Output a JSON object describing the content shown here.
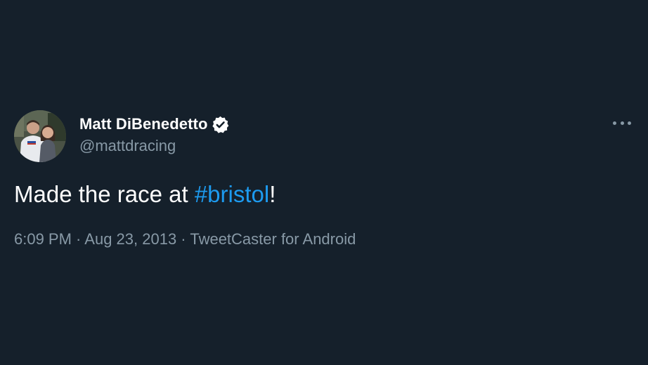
{
  "author": {
    "display_name": "Matt DiBenedetto",
    "handle": "@mattdracing",
    "verified_icon": "verified-badge-icon",
    "avatar_icon": "avatar-photo"
  },
  "tweet": {
    "text_before": "Made the race at ",
    "hashtag": "#bristol",
    "text_after": "!",
    "time": "6:09 PM",
    "separator": " · ",
    "date": "Aug 23, 2013",
    "source": "TweetCaster for Android"
  },
  "more_menu_icon": "more-options-icon",
  "colors": {
    "background": "#15202b",
    "text_primary": "#ffffff",
    "text_secondary": "#8899a6",
    "link": "#1d9bf0"
  }
}
